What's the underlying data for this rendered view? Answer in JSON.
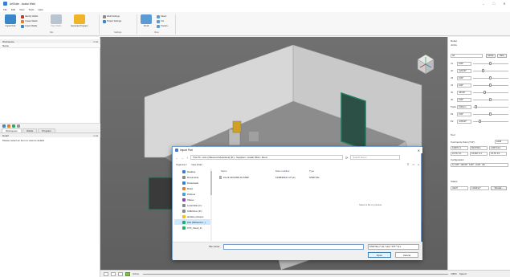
{
  "window": {
    "title": "ArtiSuite - Avatar Weld",
    "minimize": "–",
    "maximize": "□",
    "close": "✕"
  },
  "menu": [
    "File",
    "Edit",
    "View",
    "Tools",
    "Help"
  ],
  "ribbon": {
    "import_part": "Import Part",
    "identify_welds": "Identify Welds",
    "create_welds": "Create Welds",
    "import_welds": "Import Welds",
    "plan_welds": "Plan Welds",
    "generate_program": "Generate Program",
    "group_file": "File",
    "weld_settings": "Weld Settings",
    "project_settings": "Project Settings",
    "group_settings": "Settings",
    "fit_all": "Fit All",
    "select": "Select",
    "cut": "Cut",
    "transform": "Transfo...",
    "group_view": "View"
  },
  "workspace": {
    "header": "Workspace",
    "header_controls": "⊡ ⊠",
    "column": "Name",
    "tabs": [
      "Workspace",
      "Welds",
      "Program"
    ],
    "active_tab": 0
  },
  "detail": {
    "header": "Detail",
    "header_controls": "⊡ ⊠",
    "text": "Please select an item to view its details"
  },
  "viewport_status": {
    "label": "Active",
    "zoom": "100%",
    "speed_label": "Speed"
  },
  "robot_panel": {
    "title": "Robot",
    "joints_title": "Joints",
    "joint_select": "All",
    "home_btn": "Home",
    "zero_btn": "Zero",
    "joints": [
      {
        "label": "J1",
        "value": "0.00°"
      },
      {
        "label": "J2",
        "value": "-120.00°"
      },
      {
        "label": "J3",
        "value": "0.00°"
      },
      {
        "label": "J4",
        "value": "0.00°"
      },
      {
        "label": "J5",
        "value": "-90.00°"
      },
      {
        "label": "J6",
        "value": "0.00°"
      },
      {
        "label": "Track",
        "value": "0.00mm"
      },
      {
        "label": "P1",
        "value": "0.00°"
      },
      {
        "label": "P2",
        "value": "-135.00°"
      }
    ],
    "tool_title": "Tool",
    "tcp_label": "Tool Centre Point (TCP)",
    "tcp_select": "world",
    "tcp_x": "0.0070, 0",
    "tcp_y": "96.0700m",
    "tcp_z": "2.0071.0m",
    "tcp_rx": "0.179, 0.1",
    "tcp_ry": "0.1120, 0.1",
    "tcp_rz": "0.179, 0.1",
    "config_title": "Configuration",
    "config_value": "0, 0.00°, 120.00°, 0.00°, -0.00°, -90...",
    "status_title": "Status",
    "valid_label": "Valid?",
    "colliding_label": "Colliding?",
    "simulate_btn": "Simulat..."
  },
  "dialog": {
    "title": "Import Part",
    "address": "This PC  ›  AAL (\\\\Reservoir\\Autoshed) (R:)  ›  Suppliers  ›  Avatar Weld  ›  Demo",
    "search_placeholder": "Search Demo",
    "organize": "Organize ▾",
    "new_folder": "New folder",
    "nav_items": [
      {
        "label": "Desktop",
        "color": "#3a7bd5"
      },
      {
        "label": "Documents",
        "color": "#8a8a8a"
      },
      {
        "label": "Downloads",
        "color": "#3a7bd5"
      },
      {
        "label": "Music",
        "color": "#e67e22"
      },
      {
        "label": "Pictures",
        "color": "#3aa8d5"
      },
      {
        "label": "Videos",
        "color": "#8e44ad"
      },
      {
        "label": "Local Disk (C:)",
        "color": "#7f8c8d"
      },
      {
        "label": "USB Drive (D:)",
        "color": "#7f8c8d"
      },
      {
        "label": "autoline pictures",
        "color": "#f1c40f"
      },
      {
        "label": "AAL (\\\\Reservoi...)",
        "color": "#27ae60"
      },
      {
        "label": "CTF_Cloud_D...",
        "color": "#27ae60"
      }
    ],
    "selected_nav": 9,
    "columns": {
      "name": "Name",
      "date": "Date modified",
      "type": "Type"
    },
    "files": [
      {
        "name": "21-21-216-0006-01.STEP",
        "date": "12/08/2024 1:27 pm",
        "type": "STEP File"
      }
    ],
    "preview_text": "Select a file to preview.",
    "file_name_label": "File name:",
    "file_name_value": "",
    "filter": "STEP files (*.stp *.step *.STP *.S) ▾",
    "open_btn": "Open",
    "cancel_btn": "Cancel"
  }
}
